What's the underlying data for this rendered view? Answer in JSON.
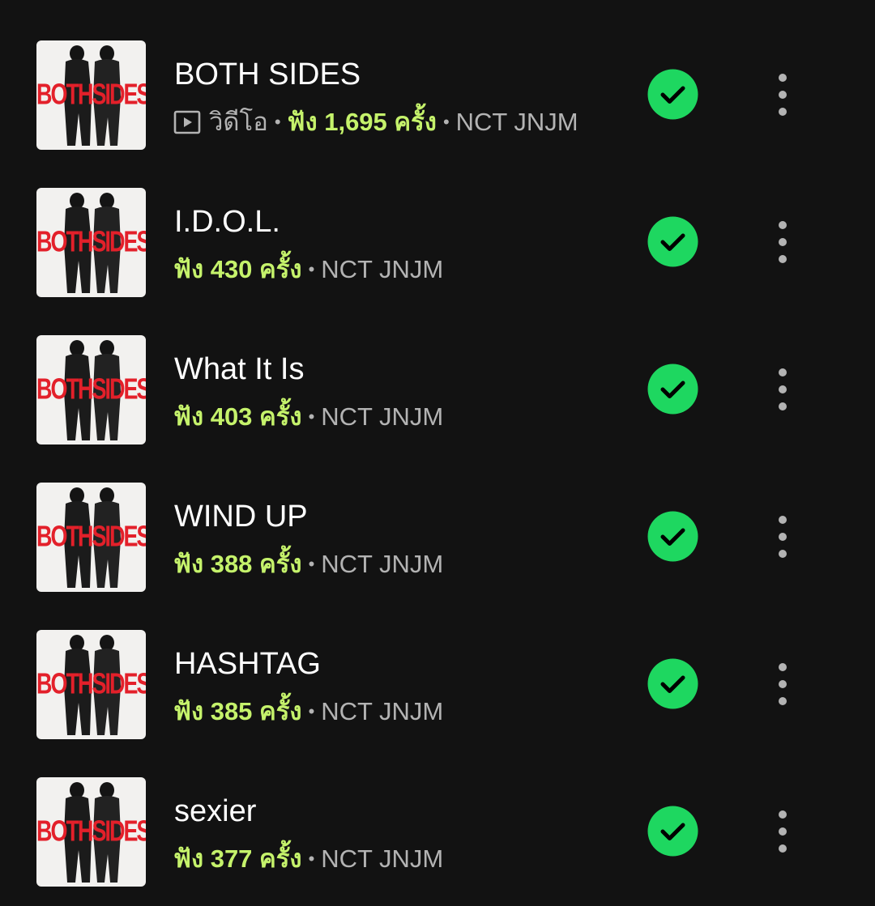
{
  "album_art": {
    "text": "BOTHSIDES"
  },
  "colors": {
    "background": "#121212",
    "accent_green": "#1ed760",
    "plays_lime": "#c5f26b",
    "secondary_text": "#b3b3b3",
    "cover_red": "#e3202a"
  },
  "icons": {
    "downloaded": "check-circle-icon",
    "more": "more-vertical-icon",
    "video": "video-play-icon"
  },
  "tracks": [
    {
      "title": "BOTH SIDES",
      "video_label": "วิดีโอ",
      "plays": "ฟัง 1,695 ครั้ง",
      "separator": "•",
      "artist": "NCT JNJM"
    },
    {
      "title": "I.D.O.L.",
      "plays": "ฟัง 430 ครั้ง",
      "separator": "•",
      "artist": "NCT JNJM"
    },
    {
      "title": "What It Is",
      "plays": "ฟัง 403 ครั้ง",
      "separator": "•",
      "artist": "NCT JNJM"
    },
    {
      "title": "WIND UP",
      "plays": "ฟัง 388 ครั้ง",
      "separator": "•",
      "artist": "NCT JNJM"
    },
    {
      "title": "HASHTAG",
      "plays": "ฟัง 385 ครั้ง",
      "separator": "•",
      "artist": "NCT JNJM"
    },
    {
      "title": "sexier",
      "plays": "ฟัง 377 ครั้ง",
      "separator": "•",
      "artist": "NCT JNJM"
    }
  ]
}
